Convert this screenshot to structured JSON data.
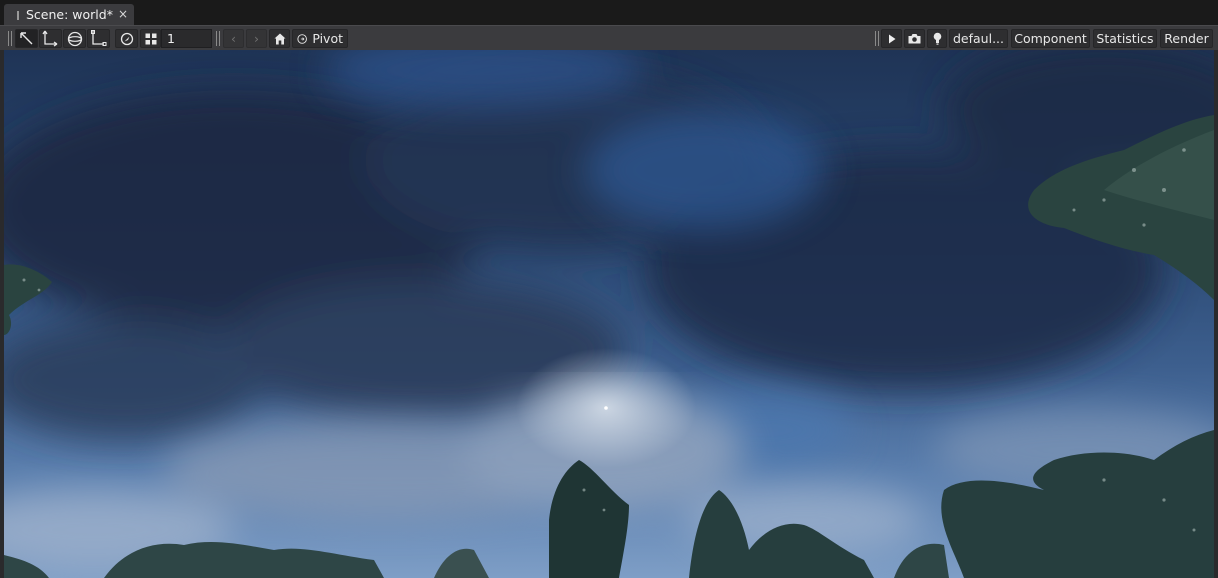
{
  "tab": {
    "title": "Scene: world*",
    "close": "×"
  },
  "toolbar": {
    "layer_value": "1",
    "pivot_label": "Pivot",
    "preset_label": "defaul...",
    "component_label": "Component",
    "statistics_label": "Statistics",
    "render_label": "Render"
  },
  "icons": {
    "select": "select-tool-icon",
    "move": "move-tool-icon",
    "rotate": "rotate-tool-icon",
    "scale": "scale-tool-icon",
    "snap": "snap-icon",
    "grid": "grid-icon",
    "prev": "chevron-left-icon",
    "next": "chevron-right-icon",
    "home": "home-icon",
    "pivot": "pivot-icon",
    "play": "play-icon",
    "camera": "camera-icon",
    "light": "light-bulb-icon"
  },
  "colors": {
    "toolbar_bg": "#3b3b3e",
    "tab_bg": "#3b3b3e",
    "sky_top": "#1f3456",
    "sky_bottom": "#7e9ec6"
  }
}
